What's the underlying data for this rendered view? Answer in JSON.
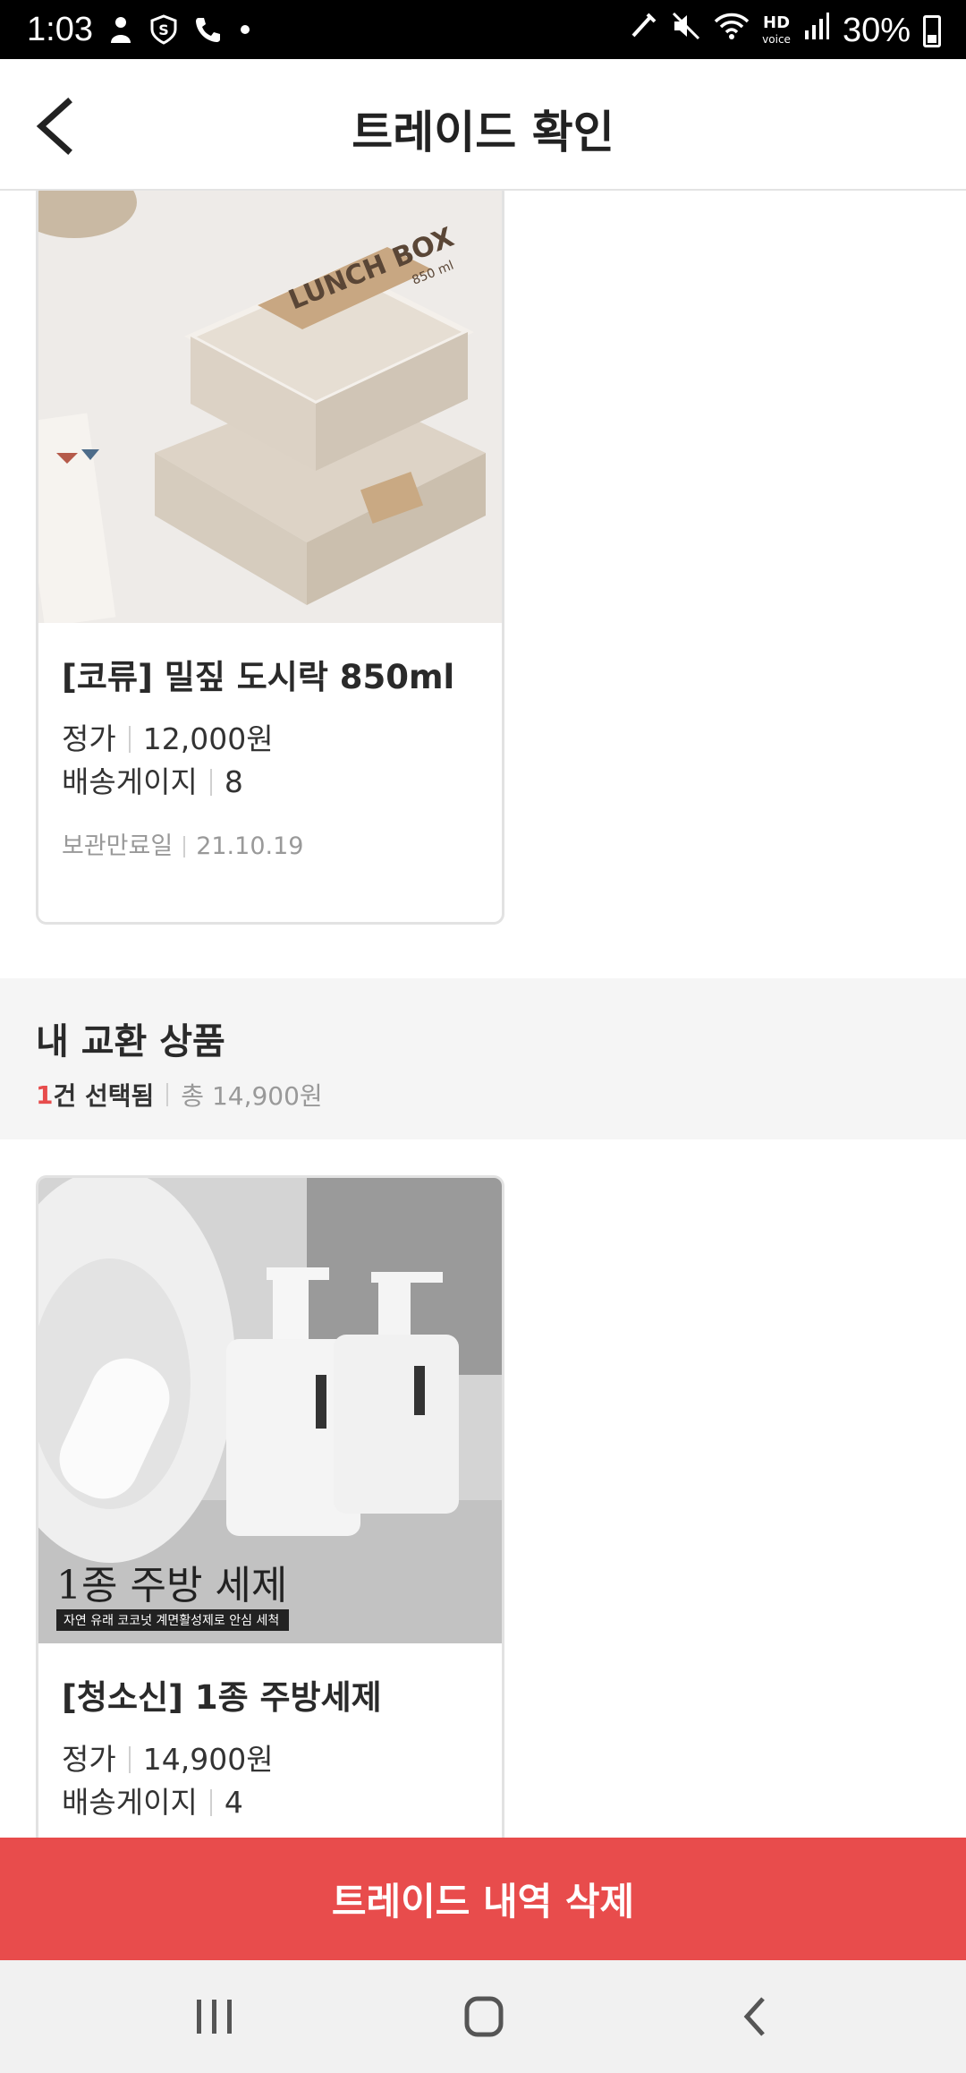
{
  "status_bar": {
    "time": "1:03",
    "battery": "30%",
    "icons": [
      "bixby-icon",
      "shield-s-icon",
      "wifi-call-icon",
      "dot-icon",
      "nfc-icon",
      "mute-icon",
      "wifi-icon",
      "hd-voice-icon",
      "signal-icon",
      "battery-icon"
    ],
    "hd_label": "HD",
    "voice_label": "voice"
  },
  "header": {
    "title": "트레이드 확인",
    "back_icon": "chevron-left-icon"
  },
  "target_item": {
    "name": "[코류] 밀짚 도시락 850ml",
    "price_label": "정가",
    "price": "12,000원",
    "gauge_label": "배송게이지",
    "gauge": "8",
    "expiry_label": "보관만료일",
    "expiry": "21.10.19",
    "image_text": {
      "box_title": "LUNCH BOX",
      "capacity": "850 ml"
    }
  },
  "my_section": {
    "title": "내 교환 상품",
    "count": "1",
    "selected_suffix": "건 선택됨",
    "total": "총 14,900원"
  },
  "my_item": {
    "name": "[청소신] 1종 주방세제",
    "price_label": "정가",
    "price": "14,900원",
    "gauge_label": "배송게이지",
    "gauge": "4",
    "image_text": {
      "headline": "1종 주방 세제",
      "caption": "자연 유래 코코넛 계면활성제로 안심 세척"
    }
  },
  "action": {
    "delete_label": "트레이드 내역 삭제"
  },
  "nav_bar": {
    "icons": [
      "recent-apps-icon",
      "home-icon",
      "back-icon"
    ]
  },
  "colors": {
    "accent": "#e84c4c",
    "section_bg": "#f5f5f5",
    "muted_text": "#999999"
  }
}
